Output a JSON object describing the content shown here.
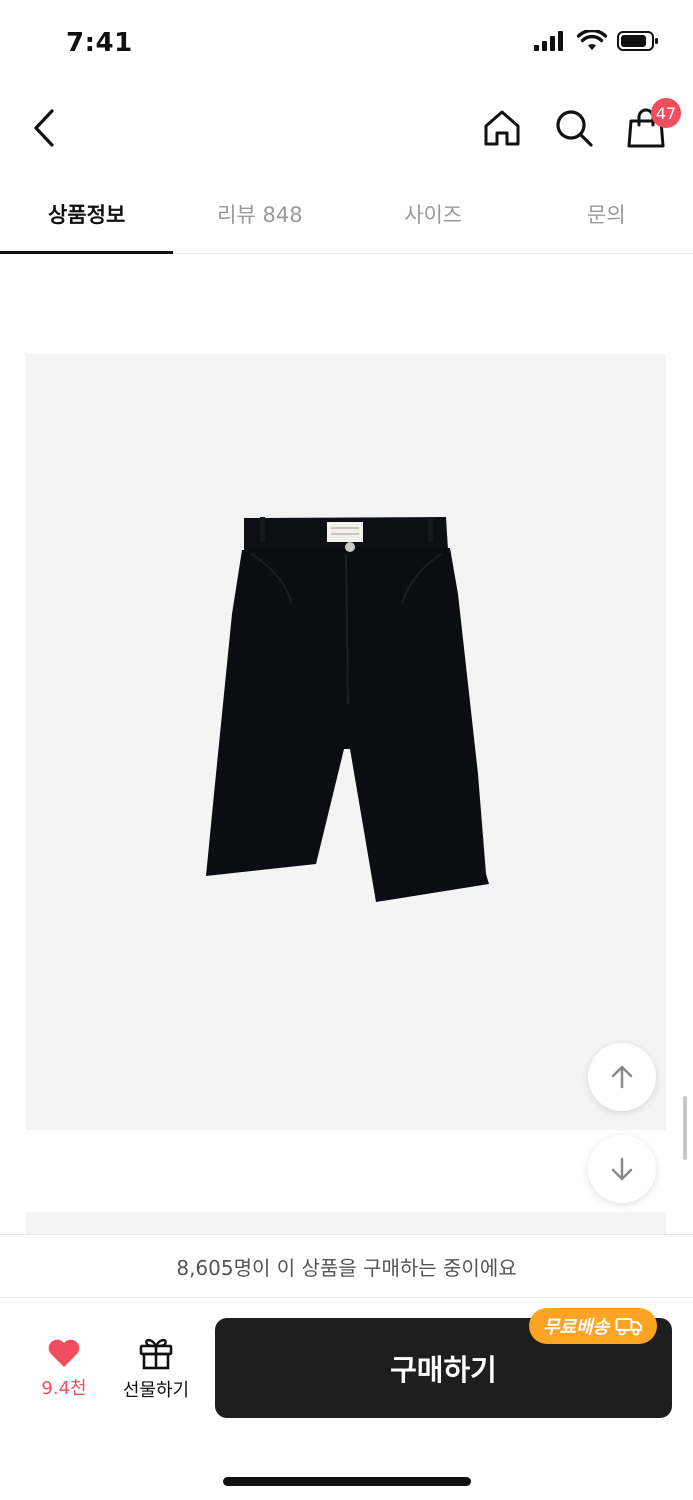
{
  "status_bar": {
    "time": "7:41"
  },
  "header": {
    "back_icon": "chevron-left-icon",
    "home_icon": "home-icon",
    "search_icon": "search-icon",
    "cart_icon": "shopping-bag-icon",
    "cart_badge": "47"
  },
  "tabs": [
    {
      "label": "상품정보",
      "active": true
    },
    {
      "label": "리뷰 848",
      "active": false
    },
    {
      "label": "사이즈",
      "active": false
    },
    {
      "label": "문의",
      "active": false
    }
  ],
  "product": {
    "image": "black bermuda pants"
  },
  "scroll_buttons": {
    "up_icon": "arrow-up-icon",
    "down_icon": "arrow-down-icon"
  },
  "notice": {
    "text": "8,605명이 이 상품을 구매하는 중이에요"
  },
  "bottom_bar": {
    "like_icon": "heart-icon",
    "like_count": "9.4천",
    "gift_icon": "gift-icon",
    "gift_label": "선물하기",
    "buy_label": "구매하기",
    "free_shipping_label": "무료배송",
    "truck_icon": "truck-icon"
  },
  "colors": {
    "accent": "#f04e5e",
    "badge_orange": "#ffa324",
    "buy_button": "#1e1e1e"
  }
}
